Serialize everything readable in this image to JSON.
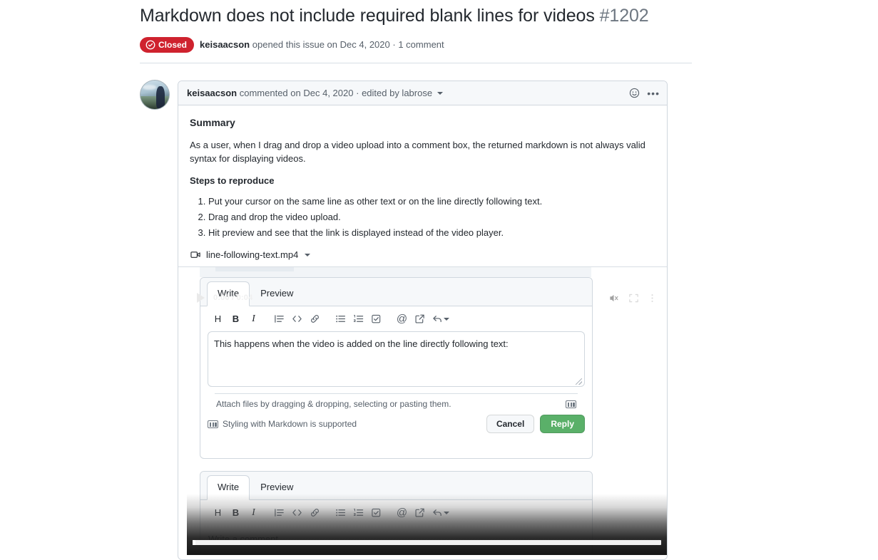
{
  "issue": {
    "title": "Markdown does not include required blank lines for videos",
    "number": "#1202",
    "state": "Closed",
    "author": "keisaacson",
    "meta_opened": "opened this issue on",
    "meta_date": "Dec 4, 2020",
    "meta_separator": "·",
    "meta_comments": "1 comment"
  },
  "comment": {
    "author": "keisaacson",
    "action": "commented on",
    "date": "Dec 4, 2020",
    "edited": "edited by labrose",
    "separator": "·",
    "emoji_icon": "smiley-icon",
    "menu_icon": "kebab-horizontal-icon",
    "heading_summary": "Summary",
    "paragraph": "As a user, when I drag and drop a video upload into a comment box, the returned markdown is not always valid syntax for displaying videos.",
    "heading_steps": "Steps to reproduce",
    "steps": [
      "Put your cursor on the same line as other text or on the line directly following text.",
      "Drag and drop the video upload.",
      "Hit preview and see that the link is displayed instead of the video player."
    ]
  },
  "attachment": {
    "icon": "device-camera-video-icon",
    "filename": "line-following-text.mp4",
    "caret": "triangle-down-icon"
  },
  "editor_top": {
    "tabs": [
      {
        "label": "Write",
        "active": true
      },
      {
        "label": "Preview",
        "active": false
      }
    ],
    "toolbar": [
      {
        "name": "heading-icon",
        "glyph": "H"
      },
      {
        "name": "bold-icon",
        "glyph": "B"
      },
      {
        "name": "italic-icon",
        "glyph": "I"
      },
      {
        "name": "quote-icon",
        "glyph": ""
      },
      {
        "name": "code-icon",
        "glyph": "<>"
      },
      {
        "name": "link-icon",
        "glyph": ""
      },
      {
        "name": "unordered-list-icon",
        "glyph": ""
      },
      {
        "name": "ordered-list-icon",
        "glyph": ""
      },
      {
        "name": "task-list-icon",
        "glyph": ""
      },
      {
        "name": "mention-icon",
        "glyph": "@"
      },
      {
        "name": "cross-reference-icon",
        "glyph": ""
      },
      {
        "name": "reply-icon",
        "glyph": ""
      }
    ],
    "textarea_value": "This happens when the video is added on the line directly following text:",
    "attach_hint": "Attach files by dragging & dropping, selecting or pasting them.",
    "attach_hint_icon": "markdown-icon",
    "markdown_note": "Styling with Markdown is supported",
    "markdown_note_icon": "markdown-icon",
    "cancel_label": "Cancel",
    "reply_label": "Reply"
  },
  "editor_bottom": {
    "tabs": [
      {
        "label": "Write",
        "active": true
      },
      {
        "label": "Preview",
        "active": false
      }
    ],
    "toolbar": [
      {
        "name": "heading-icon",
        "glyph": "H"
      },
      {
        "name": "bold-icon",
        "glyph": "B"
      },
      {
        "name": "italic-icon",
        "glyph": "I"
      },
      {
        "name": "quote-icon",
        "glyph": ""
      },
      {
        "name": "code-icon",
        "glyph": "<>"
      },
      {
        "name": "link-icon",
        "glyph": ""
      },
      {
        "name": "unordered-list-icon",
        "glyph": ""
      },
      {
        "name": "ordered-list-icon",
        "glyph": ""
      },
      {
        "name": "task-list-icon",
        "glyph": ""
      },
      {
        "name": "mention-icon",
        "glyph": "@"
      },
      {
        "name": "cross-reference-icon",
        "glyph": ""
      },
      {
        "name": "reply-icon",
        "glyph": ""
      }
    ],
    "placeholder": "Write a comment"
  },
  "video_player": {
    "play_icon": "play-icon",
    "time_display": "0:00 / 0:04",
    "current_time": "0:00",
    "duration": "0:04",
    "mute_icon": "mute-icon",
    "fullscreen_icon": "fullscreen-icon",
    "more_icon": "kebab-vertical-icon",
    "progress_percent": 0.6
  },
  "colors": {
    "closed_red": "#cf222e",
    "reply_green": "#5ab069",
    "border": "#d0d7de",
    "text": "#24292f",
    "muted": "#57606a",
    "header_bg": "#f6f8fa"
  }
}
